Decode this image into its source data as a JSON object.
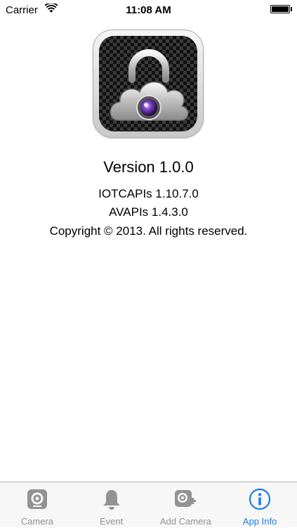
{
  "status_bar": {
    "carrier": "Carrier",
    "time": "11:08 AM",
    "battery_level": 1.0
  },
  "app_icon": {
    "name": "lock-cloud-camera-icon"
  },
  "info": {
    "version": "Version 1.0.0",
    "iotcapis": "IOTCAPIs 1.10.7.0",
    "avapis": "AVAPIs 1.4.3.0",
    "copyright": "Copyright © 2013. All rights reserved."
  },
  "tab_bar": {
    "active_color": "#1a7fe8",
    "inactive_color": "#929292",
    "tabs": [
      {
        "label": "Camera",
        "icon": "camera-icon",
        "active": false
      },
      {
        "label": "Event",
        "icon": "bell-icon",
        "active": false
      },
      {
        "label": "Add Camera",
        "icon": "add-camera-icon",
        "active": false
      },
      {
        "label": "App Info",
        "icon": "info-icon",
        "active": true
      }
    ]
  }
}
